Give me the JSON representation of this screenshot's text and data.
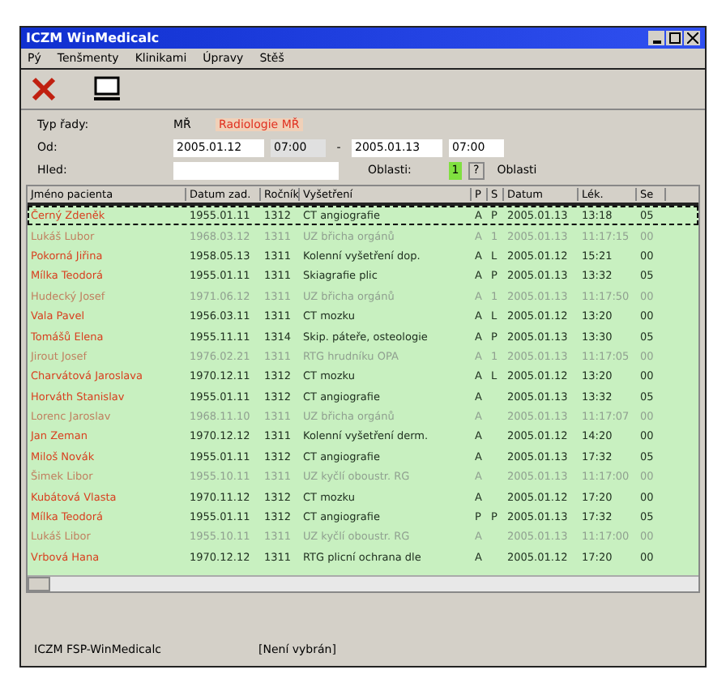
{
  "window": {
    "title": "ICZM  WinMedicalc"
  },
  "menu": [
    "Pý",
    "Tenšmenty",
    "Klinikami",
    "Úpravy",
    "Stěš"
  ],
  "form": {
    "type_label": "Typ řady:",
    "type_code": "MŘ",
    "type_name": "Radiologie  MŘ",
    "from_label": "Od:",
    "date_from": "2005.01.12",
    "time_from": "07:00",
    "dash": "-",
    "date_to": "2005.01.13",
    "time_to": "07:00",
    "search_label": "Hled:",
    "area_label": "Oblasti:",
    "area_value": "1",
    "area_button": "?",
    "area_name": "Oblasti"
  },
  "table": {
    "columns": [
      "Jméno pacienta",
      "Datum zad.",
      "Ročník",
      "Vyšetření",
      "P",
      "S",
      "Datum",
      "Lék.",
      "Se"
    ],
    "rows": [
      {
        "kind": "active",
        "selected": true,
        "cells": [
          "Černý Zdeněk",
          "1955.01.11",
          "1312",
          "CT angiografie",
          "A",
          "P",
          "2005.01.13",
          "13:18",
          "05"
        ]
      },
      {
        "kind": "pending",
        "selected": false,
        "cells": [
          "Lukáš Lubor",
          "1968.03.12",
          "1311",
          "UZ břicha orgánů",
          "A",
          "1",
          "2005.01.13",
          "11:17:15",
          "00"
        ]
      },
      {
        "kind": "active",
        "selected": false,
        "cells": [
          "Pokorná Jiřina",
          "1958.05.13",
          "1311",
          "Kolenní vyšetření dop.",
          "A",
          "L",
          "2005.01.12",
          "15:21",
          "00"
        ]
      },
      {
        "kind": "active",
        "selected": false,
        "cells": [
          "Mílka Teodorá",
          "1955.01.11",
          "1311",
          "Skiagrafie plic",
          "A",
          "P",
          "2005.01.13",
          "13:32",
          "05"
        ]
      },
      {
        "kind": "pending",
        "selected": false,
        "cells": [
          "Hudecký Josef",
          "1971.06.12",
          "1311",
          "UZ břicha orgánů",
          "A",
          "1",
          "2005.01.13",
          "11:17:50",
          "00"
        ]
      },
      {
        "kind": "active",
        "selected": false,
        "cells": [
          "Vala Pavel",
          "1956.03.11",
          "1311",
          "CT mozku",
          "A",
          "L",
          "2005.01.12",
          "13:20",
          "00"
        ]
      },
      {
        "kind": "active",
        "selected": false,
        "cells": [
          "Tomášů Elena",
          "1955.11.11",
          "1314",
          "Skip. páteře, osteologie",
          "A",
          "P",
          "2005.01.13",
          "13:30",
          "05"
        ]
      },
      {
        "kind": "pending",
        "selected": false,
        "cells": [
          "Jirout Josef",
          "1976.02.21",
          "1311",
          "RTG hrudníku OPA",
          "A",
          "1",
          "2005.01.13",
          "11:17:05",
          "00"
        ]
      },
      {
        "kind": "active",
        "selected": false,
        "cells": [
          "Charvátová Jaroslava",
          "1970.12.11",
          "1312",
          "CT mozku",
          "A",
          "L",
          "2005.01.12",
          "13:20",
          "00"
        ]
      },
      {
        "kind": "active",
        "selected": false,
        "cells": [
          "Horváth Stanislav",
          "1955.01.11",
          "1312",
          "CT angiografie",
          "A",
          "",
          "2005.01.13",
          "13:32",
          "05"
        ]
      },
      {
        "kind": "pending",
        "selected": false,
        "cells": [
          "Lorenc Jaroslav",
          "1968.11.10",
          "1311",
          "UZ břicha orgánů",
          "A",
          "",
          "2005.01.13",
          "11:17:07",
          "00"
        ]
      },
      {
        "kind": "active",
        "selected": false,
        "cells": [
          "Jan Zeman",
          "1970.12.12",
          "1311",
          "Kolenní vyšetření derm.",
          "A",
          "",
          "2005.01.12",
          "14:20",
          "00"
        ]
      },
      {
        "kind": "active",
        "selected": false,
        "cells": [
          "Miloš Novák",
          "1955.01.11",
          "1312",
          "CT angiografie",
          "A",
          "",
          "2005.01.13",
          "17:32",
          "05"
        ]
      },
      {
        "kind": "pending",
        "selected": false,
        "cells": [
          "Šimek Libor",
          "1955.10.11",
          "1311",
          "UZ kyčlí oboustr. RG",
          "A",
          "",
          "2005.01.13",
          "11:17:00",
          "00"
        ]
      },
      {
        "kind": "active",
        "selected": false,
        "cells": [
          "Kubátová Vlasta",
          "1970.11.12",
          "1312",
          "CT mozku",
          "A",
          "",
          "2005.01.12",
          "17:20",
          "00"
        ]
      },
      {
        "kind": "active",
        "selected": false,
        "cells": [
          "Mílka Teodorá",
          "1955.01.11",
          "1312",
          "CT angiografie",
          "P",
          "P",
          "2005.01.13",
          "17:32",
          "05"
        ]
      },
      {
        "kind": "pending",
        "selected": false,
        "cells": [
          "Lukáš Libor",
          "1955.10.11",
          "1311",
          "UZ kyčlí oboustr. RG",
          "A",
          "",
          "2005.01.13",
          "11:17:00",
          "00"
        ]
      },
      {
        "kind": "active",
        "selected": false,
        "cells": [
          "Vrbová Hana",
          "1970.12.12",
          "1311",
          "RTG plicní ochrana dle",
          "A",
          "",
          "2005.01.12",
          "17:20",
          "00"
        ]
      }
    ]
  },
  "status_bar": [
    "ICZM FSP-WinMedicalc",
    "[Není vybrán]"
  ]
}
